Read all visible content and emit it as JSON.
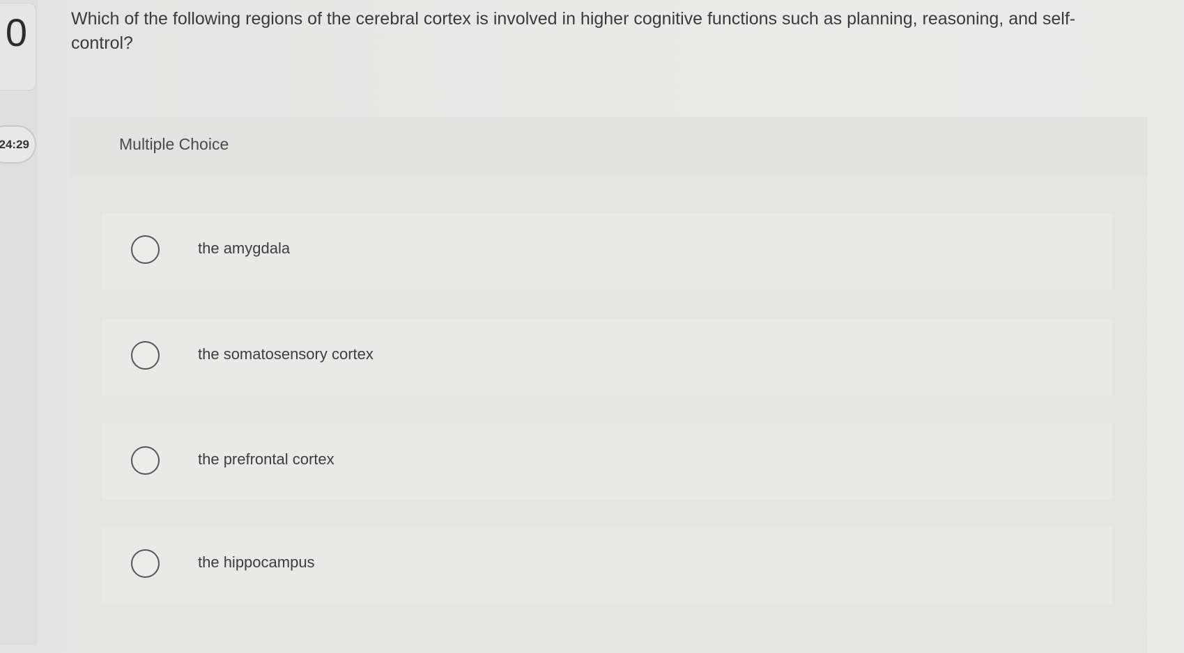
{
  "question": {
    "number": "0",
    "timer": "24:29",
    "text": "Which of the following regions of the cerebral cortex is involved in higher cognitive functions such as planning, reasoning, and self-control?"
  },
  "answer_card": {
    "type_label": "Multiple Choice",
    "options": [
      {
        "label": "the amygdala",
        "selected": false
      },
      {
        "label": "the somatosensory cortex",
        "selected": false
      },
      {
        "label": "the prefrontal cortex",
        "selected": false
      },
      {
        "label": "the hippocampus",
        "selected": false
      }
    ]
  }
}
